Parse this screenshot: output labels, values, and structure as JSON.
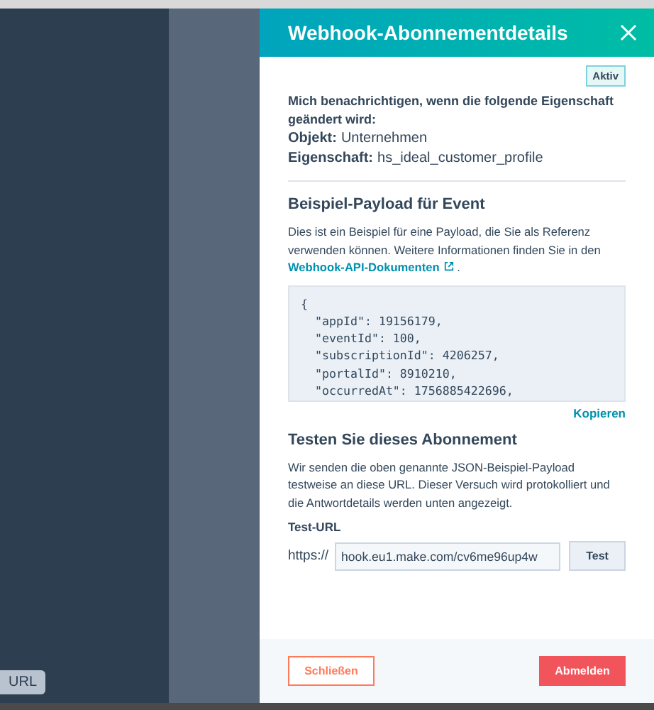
{
  "backdrop": {
    "tooltip": "URL"
  },
  "panel": {
    "title": "Webhook-Abonnementdetails",
    "status_badge": "Aktiv",
    "notify_text": "Mich benachrichtigen, wenn die folgende Eigenschaft geändert wird:",
    "fields": [
      {
        "label": "Objekt:",
        "value": "Unternehmen"
      },
      {
        "label": "Eigenschaft:",
        "value": "hs_ideal_customer_profile"
      }
    ],
    "payload_section": {
      "heading": "Beispiel-Payload für Event",
      "description": "Dies ist ein Beispiel für eine Payload, die Sie als Referenz verwenden können. Weitere Informationen finden Sie in den",
      "link": "Webhook-API-Dokumenten",
      "description_end": ".",
      "code_lines": [
        "{",
        "  \"appId\": 19156179,",
        "  \"eventId\": 100,",
        "  \"subscriptionId\": 4206257,",
        "  \"portalId\": 8910210,",
        "  \"occurredAt\": 1756885422696,"
      ],
      "copy_link": "Kopieren"
    },
    "test_section": {
      "heading": "Testen Sie dieses Abonnement",
      "description": "Wir senden die oben genannte JSON-Beispiel-Payload testweise an diese URL. Dieser Versuch wird protokolliert und die Antwortdetails werden unten angezeigt.",
      "url_label": "Test-URL",
      "url_prefix": "https://",
      "url_value": "hook.eu1.make.com/cv6me96up4w",
      "test_button": "Test"
    },
    "footer": {
      "close_button": "Schließen",
      "unsubscribe_button": "Abmelden"
    }
  }
}
